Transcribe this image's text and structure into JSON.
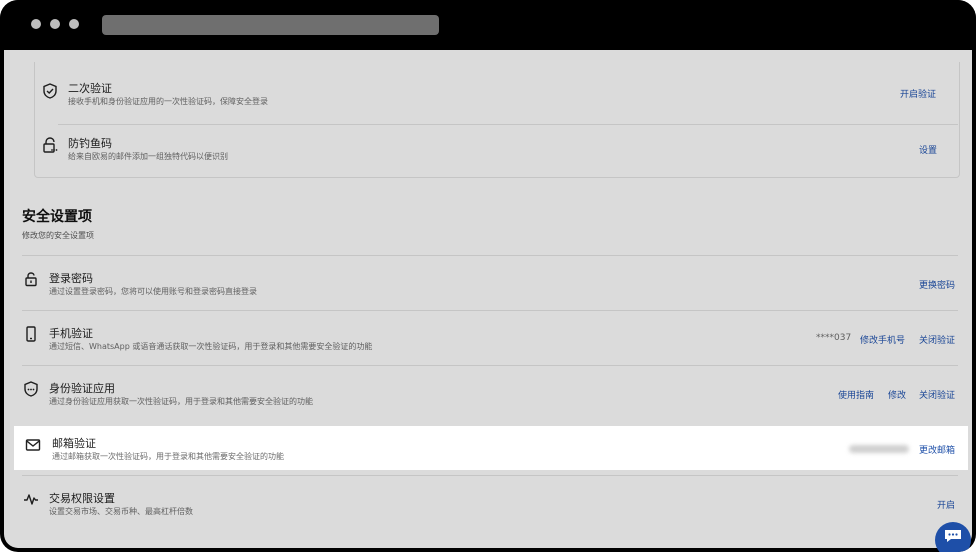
{
  "top_card": {
    "rows": [
      {
        "title": "二次验证",
        "desc": "接收手机和身份验证应用的一次性验证码，保障安全登录",
        "action": "开启验证",
        "icon": "shield-check-icon"
      },
      {
        "title": "防钓鱼码",
        "desc": "给来自欧易的邮件添加一组独特代码以便识别",
        "action": "设置",
        "icon": "lock-dots-icon"
      }
    ]
  },
  "security_section": {
    "title": "安全设置项",
    "subtitle": "修改您的安全设置项",
    "rows": [
      {
        "title": "登录密码",
        "desc": "通过设置登录密码，您将可以使用账号和登录密码直接登录",
        "actions": [
          "更换密码"
        ],
        "icon": "padlock-icon"
      },
      {
        "title": "手机验证",
        "desc": "通过短信、WhatsApp 或语音通话获取一次性验证码，用于登录和其他需要安全验证的功能",
        "meta": "****037",
        "actions": [
          "修改手机号",
          "关闭验证"
        ],
        "icon": "phone-icon"
      },
      {
        "title": "身份验证应用",
        "desc": "通过身份验证应用获取一次性验证码，用于登录和其他需要安全验证的功能",
        "actions": [
          "使用指南",
          "修改",
          "关闭验证"
        ],
        "icon": "shield-dots-icon"
      },
      {
        "title": "邮箱验证",
        "desc": "通过邮箱获取一次性验证码，用于登录和其他需要安全验证的功能",
        "actions": [
          "更改邮箱"
        ],
        "icon": "mail-icon"
      },
      {
        "title": "交易权限设置",
        "desc": "设置交易市场、交易币种、最高杠杆倍数",
        "actions": [
          "开启"
        ],
        "icon": "pulse-icon"
      }
    ]
  },
  "colors": {
    "accent": "#1e4fa8",
    "overlay": "#000000",
    "background": "#f4f4f4"
  }
}
